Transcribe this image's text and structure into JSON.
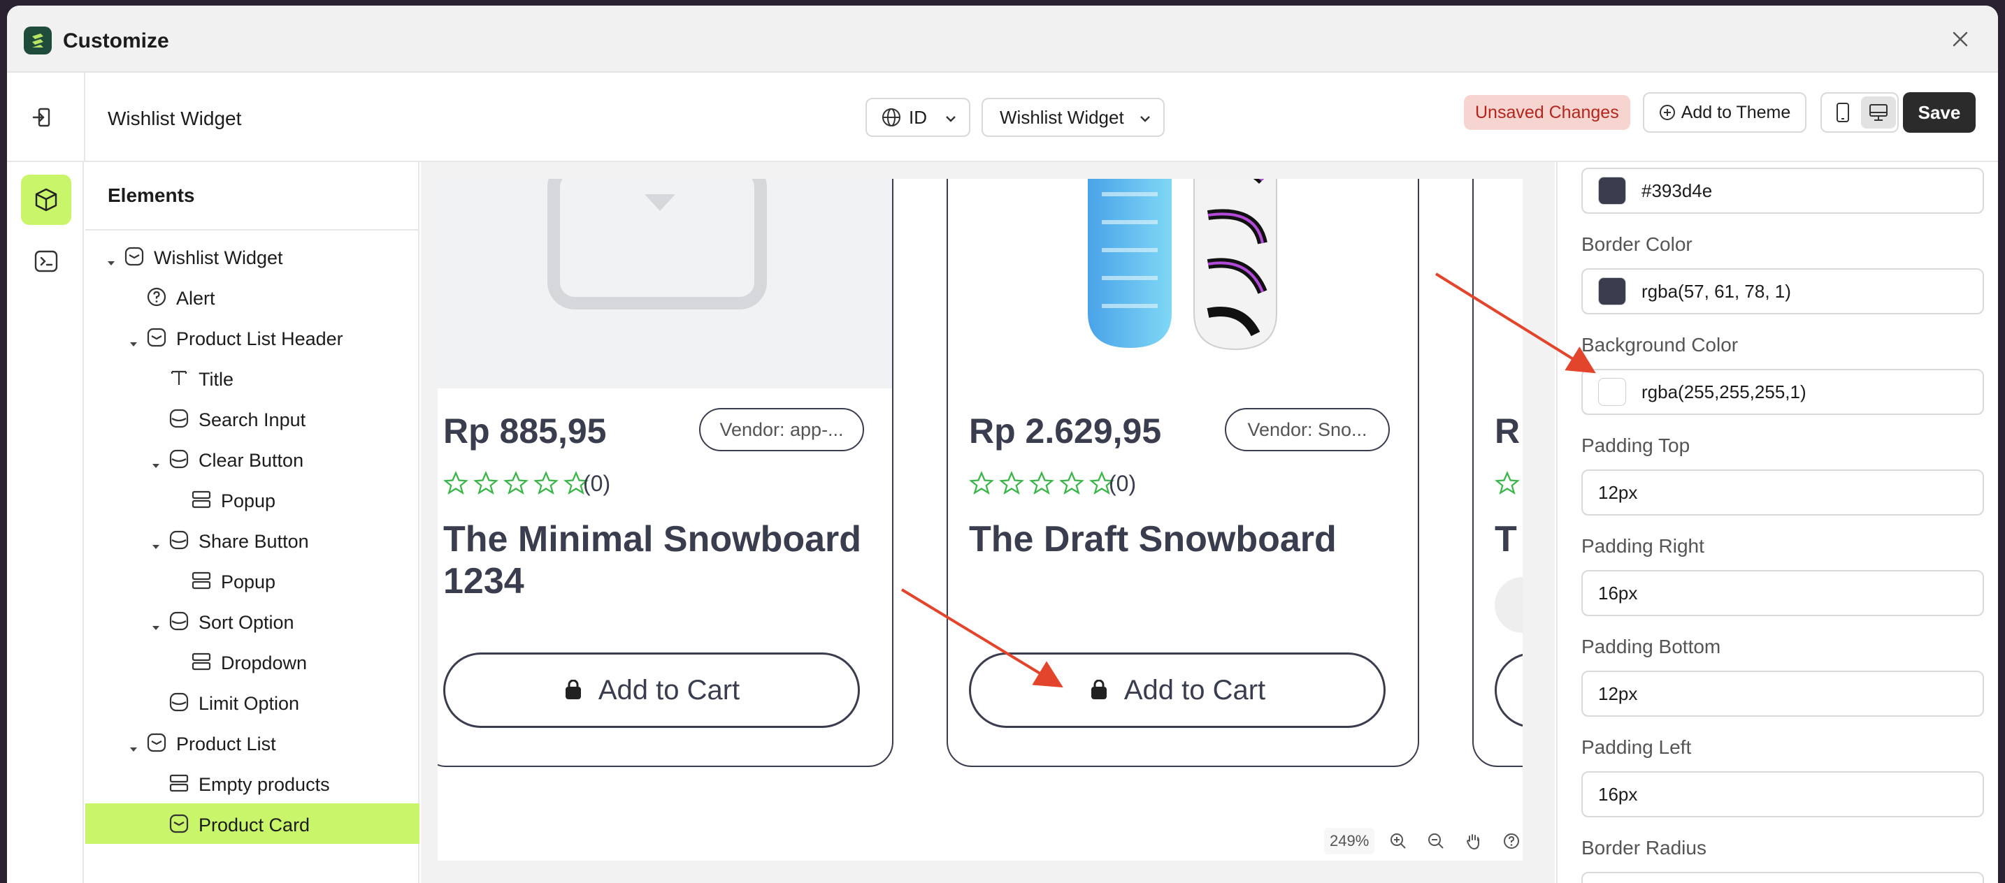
{
  "window": {
    "title": "Customize",
    "brand_color": "#1f4b3a",
    "accent_color": "#c8f56a"
  },
  "toolbar": {
    "page_name": "Wishlist Widget",
    "language_select": "ID",
    "widget_select": "Wishlist Widget",
    "unsaved_label": "Unsaved Changes",
    "add_to_theme_label": "Add to Theme",
    "save_label": "Save"
  },
  "panel": {
    "title": "Elements",
    "items": [
      {
        "label": "Wishlist Widget",
        "depth": 0,
        "expanded": true,
        "icon": "component-icon"
      },
      {
        "label": "Alert",
        "depth": 1,
        "icon": "help-circle-icon"
      },
      {
        "label": "Product List Header",
        "depth": 1,
        "expanded": true,
        "icon": "component-icon"
      },
      {
        "label": "Title",
        "depth": 2,
        "icon": "text-icon"
      },
      {
        "label": "Search Input",
        "depth": 2,
        "icon": "square-icon"
      },
      {
        "label": "Clear Button",
        "depth": 2,
        "expanded": true,
        "icon": "square-icon"
      },
      {
        "label": "Popup",
        "depth": 3,
        "icon": "rows-icon"
      },
      {
        "label": "Share Button",
        "depth": 2,
        "expanded": true,
        "icon": "square-icon"
      },
      {
        "label": "Popup",
        "depth": 3,
        "icon": "rows-icon"
      },
      {
        "label": "Sort Option",
        "depth": 2,
        "expanded": true,
        "icon": "square-icon"
      },
      {
        "label": "Dropdown",
        "depth": 3,
        "icon": "rows-icon"
      },
      {
        "label": "Limit Option",
        "depth": 2,
        "icon": "square-icon"
      },
      {
        "label": "Product List",
        "depth": 1,
        "expanded": true,
        "icon": "component-icon"
      },
      {
        "label": "Empty products",
        "depth": 2,
        "icon": "rows-icon"
      },
      {
        "label": "Product Card",
        "depth": 2,
        "icon": "component-icon",
        "selected": true
      }
    ]
  },
  "canvas": {
    "zoom": "249%",
    "cards": [
      {
        "price": "Rp 885,95",
        "vendor": "Vendor: app-...",
        "reviews": "(0)",
        "title": "The Minimal Snowboard 1234",
        "button": "Add to Cart"
      },
      {
        "price": "Rp 2.629,95",
        "vendor": "Vendor: Sno...",
        "reviews": "(0)",
        "title": "The Draft Snowboard",
        "button": "Add to Cart"
      }
    ],
    "partial_card": {
      "price_initial": "R",
      "title_initial": "T"
    },
    "star_color": "#3bb54a",
    "text_color": "#393d4e"
  },
  "inspector": {
    "fields": [
      {
        "label": "",
        "value": "#393d4e",
        "swatch": "#393d4e"
      },
      {
        "label": "Border Color",
        "value": "rgba(57, 61, 78, 1)",
        "swatch": "#393d4e"
      },
      {
        "label": "Background Color",
        "value": "rgba(255,255,255,1)",
        "swatch": "#ffffff"
      },
      {
        "label": "Padding Top",
        "value": "12px"
      },
      {
        "label": "Padding Right",
        "value": "16px"
      },
      {
        "label": "Padding Bottom",
        "value": "12px"
      },
      {
        "label": "Padding Left",
        "value": "16px"
      },
      {
        "label": "Border Radius",
        "value": ""
      }
    ]
  },
  "annotation_color": "#e2452c"
}
